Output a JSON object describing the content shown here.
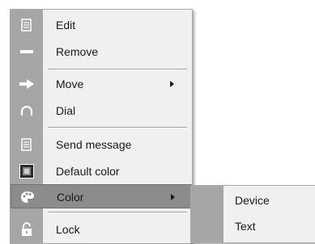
{
  "context_menu": {
    "items": [
      {
        "label": "Edit",
        "icon": "edit-note-icon"
      },
      {
        "label": "Remove",
        "icon": "minus-bar-icon"
      },
      {
        "label": "Move",
        "icon": "right-arrow-icon",
        "has_submenu": true
      },
      {
        "label": "Dial",
        "icon": "arc-icon"
      },
      {
        "label": "Send message",
        "icon": "message-note-icon"
      },
      {
        "label": "Default color",
        "icon": "default-color-icon"
      },
      {
        "label": "Color",
        "icon": "palette-icon",
        "has_submenu": true,
        "highlighted": true
      },
      {
        "label": "Lock",
        "icon": "lock-icon"
      }
    ]
  },
  "color_submenu": {
    "items": [
      {
        "label": "Device"
      },
      {
        "label": "Text"
      }
    ]
  },
  "colors": {
    "menu_bg": "#f0f0f0",
    "gutter": "#a6a6a6",
    "highlight": "#8c8c8c"
  }
}
